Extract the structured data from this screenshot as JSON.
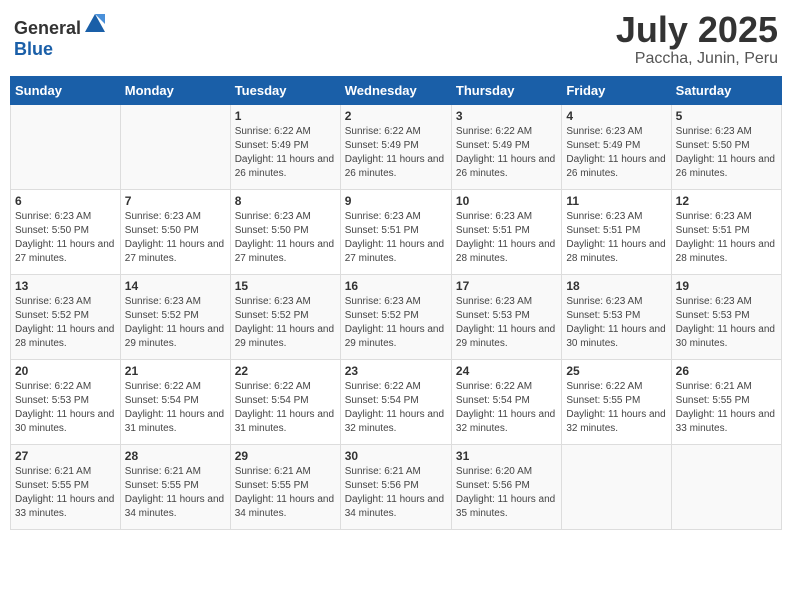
{
  "header": {
    "logo_general": "General",
    "logo_blue": "Blue",
    "month": "July 2025",
    "location": "Paccha, Junin, Peru"
  },
  "days_of_week": [
    "Sunday",
    "Monday",
    "Tuesday",
    "Wednesday",
    "Thursday",
    "Friday",
    "Saturday"
  ],
  "weeks": [
    [
      {
        "day": "",
        "info": ""
      },
      {
        "day": "",
        "info": ""
      },
      {
        "day": "1",
        "info": "Sunrise: 6:22 AM\nSunset: 5:49 PM\nDaylight: 11 hours and 26 minutes."
      },
      {
        "day": "2",
        "info": "Sunrise: 6:22 AM\nSunset: 5:49 PM\nDaylight: 11 hours and 26 minutes."
      },
      {
        "day": "3",
        "info": "Sunrise: 6:22 AM\nSunset: 5:49 PM\nDaylight: 11 hours and 26 minutes."
      },
      {
        "day": "4",
        "info": "Sunrise: 6:23 AM\nSunset: 5:49 PM\nDaylight: 11 hours and 26 minutes."
      },
      {
        "day": "5",
        "info": "Sunrise: 6:23 AM\nSunset: 5:50 PM\nDaylight: 11 hours and 26 minutes."
      }
    ],
    [
      {
        "day": "6",
        "info": "Sunrise: 6:23 AM\nSunset: 5:50 PM\nDaylight: 11 hours and 27 minutes."
      },
      {
        "day": "7",
        "info": "Sunrise: 6:23 AM\nSunset: 5:50 PM\nDaylight: 11 hours and 27 minutes."
      },
      {
        "day": "8",
        "info": "Sunrise: 6:23 AM\nSunset: 5:50 PM\nDaylight: 11 hours and 27 minutes."
      },
      {
        "day": "9",
        "info": "Sunrise: 6:23 AM\nSunset: 5:51 PM\nDaylight: 11 hours and 27 minutes."
      },
      {
        "day": "10",
        "info": "Sunrise: 6:23 AM\nSunset: 5:51 PM\nDaylight: 11 hours and 28 minutes."
      },
      {
        "day": "11",
        "info": "Sunrise: 6:23 AM\nSunset: 5:51 PM\nDaylight: 11 hours and 28 minutes."
      },
      {
        "day": "12",
        "info": "Sunrise: 6:23 AM\nSunset: 5:51 PM\nDaylight: 11 hours and 28 minutes."
      }
    ],
    [
      {
        "day": "13",
        "info": "Sunrise: 6:23 AM\nSunset: 5:52 PM\nDaylight: 11 hours and 28 minutes."
      },
      {
        "day": "14",
        "info": "Sunrise: 6:23 AM\nSunset: 5:52 PM\nDaylight: 11 hours and 29 minutes."
      },
      {
        "day": "15",
        "info": "Sunrise: 6:23 AM\nSunset: 5:52 PM\nDaylight: 11 hours and 29 minutes."
      },
      {
        "day": "16",
        "info": "Sunrise: 6:23 AM\nSunset: 5:52 PM\nDaylight: 11 hours and 29 minutes."
      },
      {
        "day": "17",
        "info": "Sunrise: 6:23 AM\nSunset: 5:53 PM\nDaylight: 11 hours and 29 minutes."
      },
      {
        "day": "18",
        "info": "Sunrise: 6:23 AM\nSunset: 5:53 PM\nDaylight: 11 hours and 30 minutes."
      },
      {
        "day": "19",
        "info": "Sunrise: 6:23 AM\nSunset: 5:53 PM\nDaylight: 11 hours and 30 minutes."
      }
    ],
    [
      {
        "day": "20",
        "info": "Sunrise: 6:22 AM\nSunset: 5:53 PM\nDaylight: 11 hours and 30 minutes."
      },
      {
        "day": "21",
        "info": "Sunrise: 6:22 AM\nSunset: 5:54 PM\nDaylight: 11 hours and 31 minutes."
      },
      {
        "day": "22",
        "info": "Sunrise: 6:22 AM\nSunset: 5:54 PM\nDaylight: 11 hours and 31 minutes."
      },
      {
        "day": "23",
        "info": "Sunrise: 6:22 AM\nSunset: 5:54 PM\nDaylight: 11 hours and 32 minutes."
      },
      {
        "day": "24",
        "info": "Sunrise: 6:22 AM\nSunset: 5:54 PM\nDaylight: 11 hours and 32 minutes."
      },
      {
        "day": "25",
        "info": "Sunrise: 6:22 AM\nSunset: 5:55 PM\nDaylight: 11 hours and 32 minutes."
      },
      {
        "day": "26",
        "info": "Sunrise: 6:21 AM\nSunset: 5:55 PM\nDaylight: 11 hours and 33 minutes."
      }
    ],
    [
      {
        "day": "27",
        "info": "Sunrise: 6:21 AM\nSunset: 5:55 PM\nDaylight: 11 hours and 33 minutes."
      },
      {
        "day": "28",
        "info": "Sunrise: 6:21 AM\nSunset: 5:55 PM\nDaylight: 11 hours and 34 minutes."
      },
      {
        "day": "29",
        "info": "Sunrise: 6:21 AM\nSunset: 5:55 PM\nDaylight: 11 hours and 34 minutes."
      },
      {
        "day": "30",
        "info": "Sunrise: 6:21 AM\nSunset: 5:56 PM\nDaylight: 11 hours and 34 minutes."
      },
      {
        "day": "31",
        "info": "Sunrise: 6:20 AM\nSunset: 5:56 PM\nDaylight: 11 hours and 35 minutes."
      },
      {
        "day": "",
        "info": ""
      },
      {
        "day": "",
        "info": ""
      }
    ]
  ]
}
